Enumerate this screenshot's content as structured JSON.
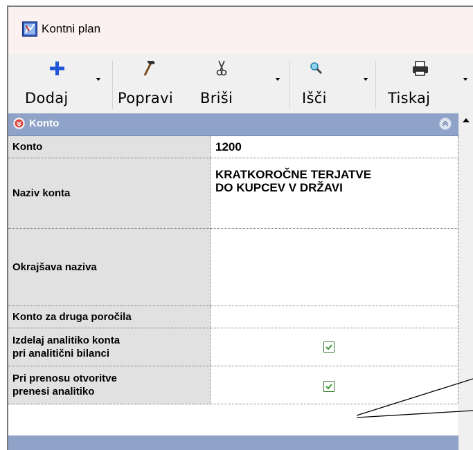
{
  "window": {
    "title": "Kontni plan"
  },
  "toolbar": {
    "buttons": [
      {
        "label": "Dodaj",
        "icon": "plus-icon"
      },
      {
        "label": "Popravi",
        "icon": "hammer-icon"
      },
      {
        "label": "Briši",
        "icon": "scissors-icon"
      },
      {
        "label": "Išči",
        "icon": "magnifier-icon"
      },
      {
        "label": "Tiskaj",
        "icon": "printer-icon"
      }
    ]
  },
  "section": {
    "title": "Konto"
  },
  "form": {
    "rows": [
      {
        "label": "Konto",
        "value": "1200"
      },
      {
        "label": "Naziv konta",
        "value_lines": [
          "KRATKOROČNE TERJATVE",
          "DO KUPCEV V DRŽAVI"
        ]
      },
      {
        "label": "Okrajšava naziva",
        "value": ""
      },
      {
        "label": "Konto za druga poročila",
        "value": ""
      },
      {
        "label_lines": [
          "Izdelaj analitiko konta",
          "pri analitični bilanci"
        ],
        "checked": true
      },
      {
        "label_lines": [
          "Pri prenosu otvoritve",
          "prenesi analitiko"
        ],
        "checked": true
      }
    ]
  },
  "colors": {
    "section_header": "#8ea3c7",
    "label_bg": "#e1e1e1",
    "check_green": "#3a9a34",
    "title_bg": "#fbf1f1"
  }
}
